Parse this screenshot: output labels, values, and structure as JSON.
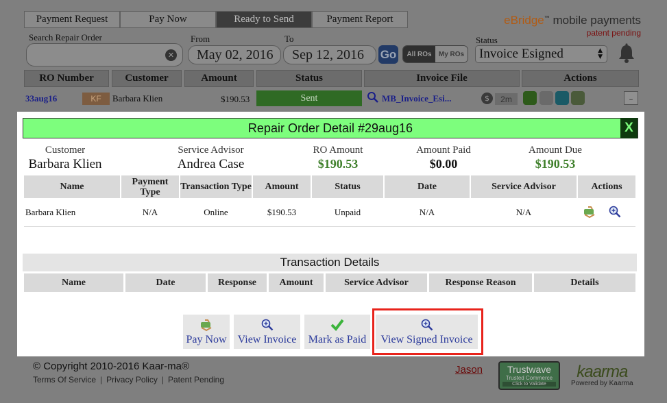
{
  "nav": {
    "tabs": [
      "Payment Request",
      "Pay Now",
      "Ready to Send",
      "Payment Report"
    ]
  },
  "brand": {
    "name_prefix": "eBridge",
    "tm": "™",
    "name_suffix": " mobile payments",
    "sub": "patent pending"
  },
  "filters": {
    "search_label": "Search Repair Order",
    "search_value": "",
    "from_label": "From",
    "from_value": "May 02, 2016",
    "to_label": "To",
    "to_value": "Sep 12, 2016",
    "go_label": "Go",
    "all_ros": "All ROs",
    "my_ros": "My ROs",
    "status_label": "Status",
    "status_value": "Invoice Esigned"
  },
  "table": {
    "columns": [
      "RO Number",
      "Customer",
      "Amount",
      "Status",
      "Invoice File",
      "Actions"
    ],
    "row": {
      "ro_number": "33aug16",
      "initials": "KF",
      "customer": "Barbara Klien",
      "amount": "$190.53",
      "status": "Sent",
      "invoice_file": "MB_Invoice_Esi...",
      "elapsed": "2m",
      "more": ".."
    }
  },
  "modal": {
    "title": "Repair Order Detail #29aug16",
    "close": "X",
    "summary": {
      "customer_label": "Customer",
      "customer_value": "Barbara Klien",
      "advisor_label": "Service Advisor",
      "advisor_value": "Andrea Case",
      "ro_amount_label": "RO Amount",
      "ro_amount_value": "$190.53",
      "paid_label": "Amount Paid",
      "paid_value": "$0.00",
      "due_label": "Amount Due",
      "due_value": "$190.53"
    },
    "payments": {
      "columns": [
        "Name",
        "Payment Type",
        "Transaction Type",
        "Amount",
        "Status",
        "Date",
        "Service Advisor",
        "Actions"
      ],
      "row": [
        "Barbara Klien",
        "N/A",
        "Online",
        "$190.53",
        "Unpaid",
        "N/A",
        "N/A"
      ]
    },
    "transactions": {
      "title": "Transaction Details",
      "columns": [
        "Name",
        "Date",
        "Response",
        "Amount",
        "Service Advisor",
        "Response Reason",
        "Details"
      ]
    },
    "buttons": {
      "pay_now": "Pay Now",
      "view_invoice": "View Invoice",
      "mark_paid": "Mark as Paid",
      "view_signed": "View Signed Invoice"
    }
  },
  "footer": {
    "copyright": "© Copyright 2010-2016 Kaar-ma®",
    "links": [
      "Terms Of Service",
      "Privacy Policy",
      "Patent Pending"
    ],
    "user": "Jason",
    "trustwave": "Trustwave",
    "trustwave_sub": "Trusted Commerce",
    "trustwave_validate": "Click to Validate",
    "kaarma_logo": "kaarma",
    "powered_by": "Powered by Kaarma"
  },
  "colors": {
    "modal_title_bg": "#7dfe7d",
    "highlight": "#e8231b",
    "link": "#2c3b9c",
    "money_green": "#3e7f2a"
  }
}
